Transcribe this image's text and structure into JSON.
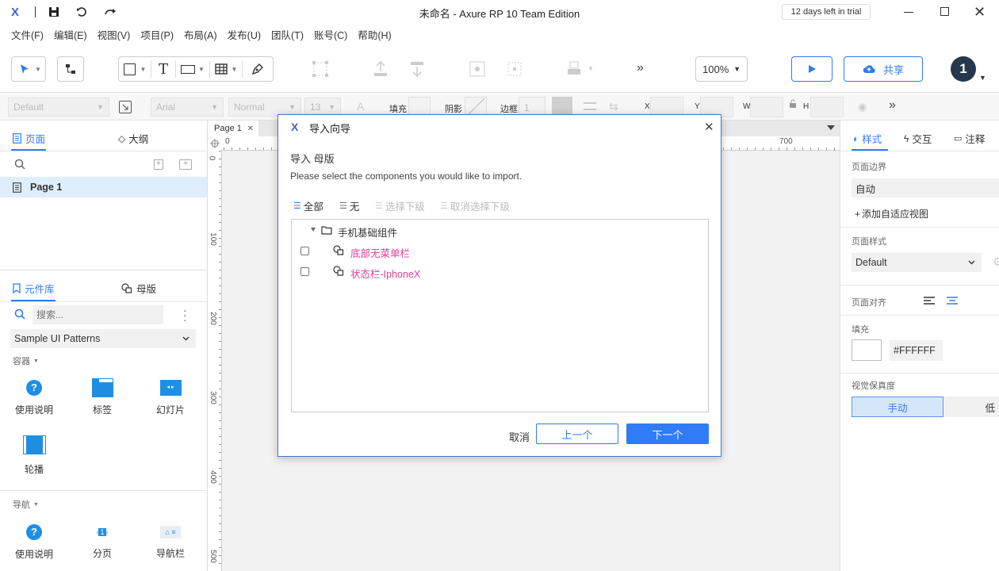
{
  "window": {
    "title": "未命名 - Axure RP 10 Team Edition",
    "trial_badge": "12 days left in trial"
  },
  "menu": [
    "文件(F)",
    "编辑(E)",
    "视图(V)",
    "项目(P)",
    "布局(A)",
    "发布(U)",
    "团队(T)",
    "账号(C)",
    "帮助(H)"
  ],
  "toolbar": {
    "zoom": "100%",
    "share_label": "共享",
    "avatar_letter": "1"
  },
  "props": {
    "style_dropdown": "Default",
    "font": "Arial",
    "weight": "Normal",
    "size": "13",
    "fill_label": "填充",
    "shadow_label": "阴影",
    "border_label": "边框",
    "border_value": "1",
    "x_label": "X",
    "y_label": "Y",
    "w_label": "W",
    "h_label": "H"
  },
  "pages_panel": {
    "tab_pages": "页面",
    "tab_outline": "大纲",
    "pages": [
      "Page 1"
    ]
  },
  "library_panel": {
    "tab_library": "元件库",
    "tab_masters": "母版",
    "search_placeholder": "搜索...",
    "library_select": "Sample UI Patterns",
    "section_container": "容器",
    "container_items": [
      "使用说明",
      "标签",
      "幻灯片",
      "轮播"
    ],
    "section_nav": "导航",
    "nav_items": [
      "使用说明",
      "分页",
      "导航栏"
    ]
  },
  "canvas": {
    "tab_label": "Page 1",
    "ruler_top": [
      "0",
      "700"
    ],
    "ruler_left": [
      "0",
      "100",
      "200",
      "300",
      "400",
      "500"
    ]
  },
  "dialog": {
    "title": "导入向导",
    "heading": "导入 母版",
    "description": "Please select the components you would like to import.",
    "btn_all": "全部",
    "btn_none": "无",
    "btn_select_children": "选择下级",
    "btn_deselect_children": "取消选择下级",
    "folder": "手机基础组件",
    "items": [
      "底部无菜单栏",
      "状态栏-IphoneX"
    ],
    "cancel": "取消",
    "prev": "上一个",
    "next": "下一个"
  },
  "right_panel": {
    "tab_style": "样式",
    "tab_interact": "交互",
    "tab_notes": "注释",
    "page_bounds_label": "页面边界",
    "page_bounds_value": "自动",
    "add_adaptive": "添加自适应视图",
    "page_style_label": "页面样式",
    "page_style_value": "Default",
    "page_align_label": "页面对齐",
    "fill_label": "填充",
    "fill_hex": "#FFFFFF",
    "fidelity_label": "视觉保真度",
    "fidelity_manual": "手动",
    "fidelity_low": "低"
  },
  "colors": {
    "accent": "#2f7cf6",
    "master_text": "#e0409a"
  }
}
